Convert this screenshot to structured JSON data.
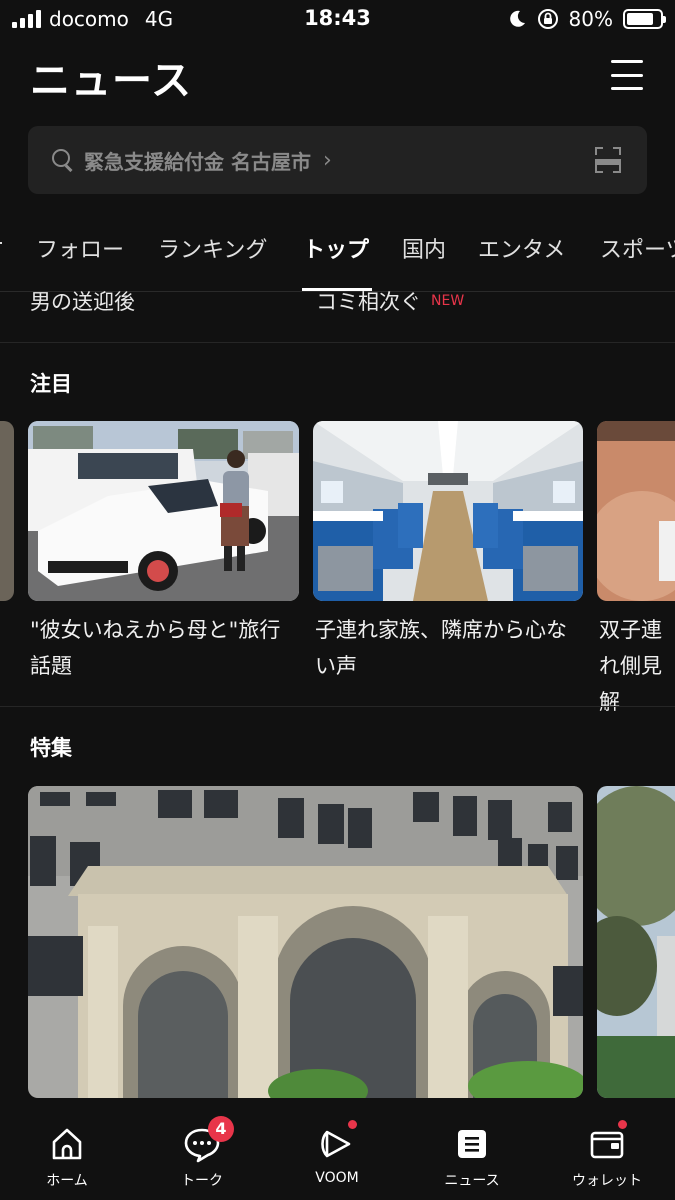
{
  "status_bar": {
    "carrier": "docomo",
    "network": "4G",
    "time": "18:43",
    "battery_percent": "80%",
    "battery_level": 0.8
  },
  "header": {
    "title": "ニュース"
  },
  "search": {
    "query": "緊急支援給付金 名古屋市",
    "chevron": "›"
  },
  "tabs": [
    {
      "label": "フォロー"
    },
    {
      "label": "ランキング"
    },
    {
      "label": "トップ",
      "active": true
    },
    {
      "label": "国内"
    },
    {
      "label": "エンタメ"
    },
    {
      "label": "スポーツ"
    }
  ],
  "partial_headlines": {
    "left": "男の送迎後",
    "right": "コミ相次ぐ",
    "right_badge": "NEW"
  },
  "attention": {
    "title": "注目",
    "cards": [
      {
        "caption": "\"彼女いねえから母と\"旅行話題"
      },
      {
        "caption": "子連れ家族、隣席から心ない声"
      },
      {
        "caption": "双子連れ側見解"
      }
    ]
  },
  "feature": {
    "title": "特集"
  },
  "bottom_nav": {
    "items": [
      {
        "label": "ホーム",
        "icon": "home-icon"
      },
      {
        "label": "トーク",
        "icon": "chat-icon",
        "badge": "4"
      },
      {
        "label": "VOOM",
        "icon": "voom-icon",
        "dot": true
      },
      {
        "label": "ニュース",
        "icon": "news-icon",
        "active": true
      },
      {
        "label": "ウォレット",
        "icon": "wallet-icon",
        "dot": true
      }
    ]
  },
  "colors": {
    "background": "#111111",
    "accent_red": "#e8354a",
    "search_bg": "#222222"
  }
}
